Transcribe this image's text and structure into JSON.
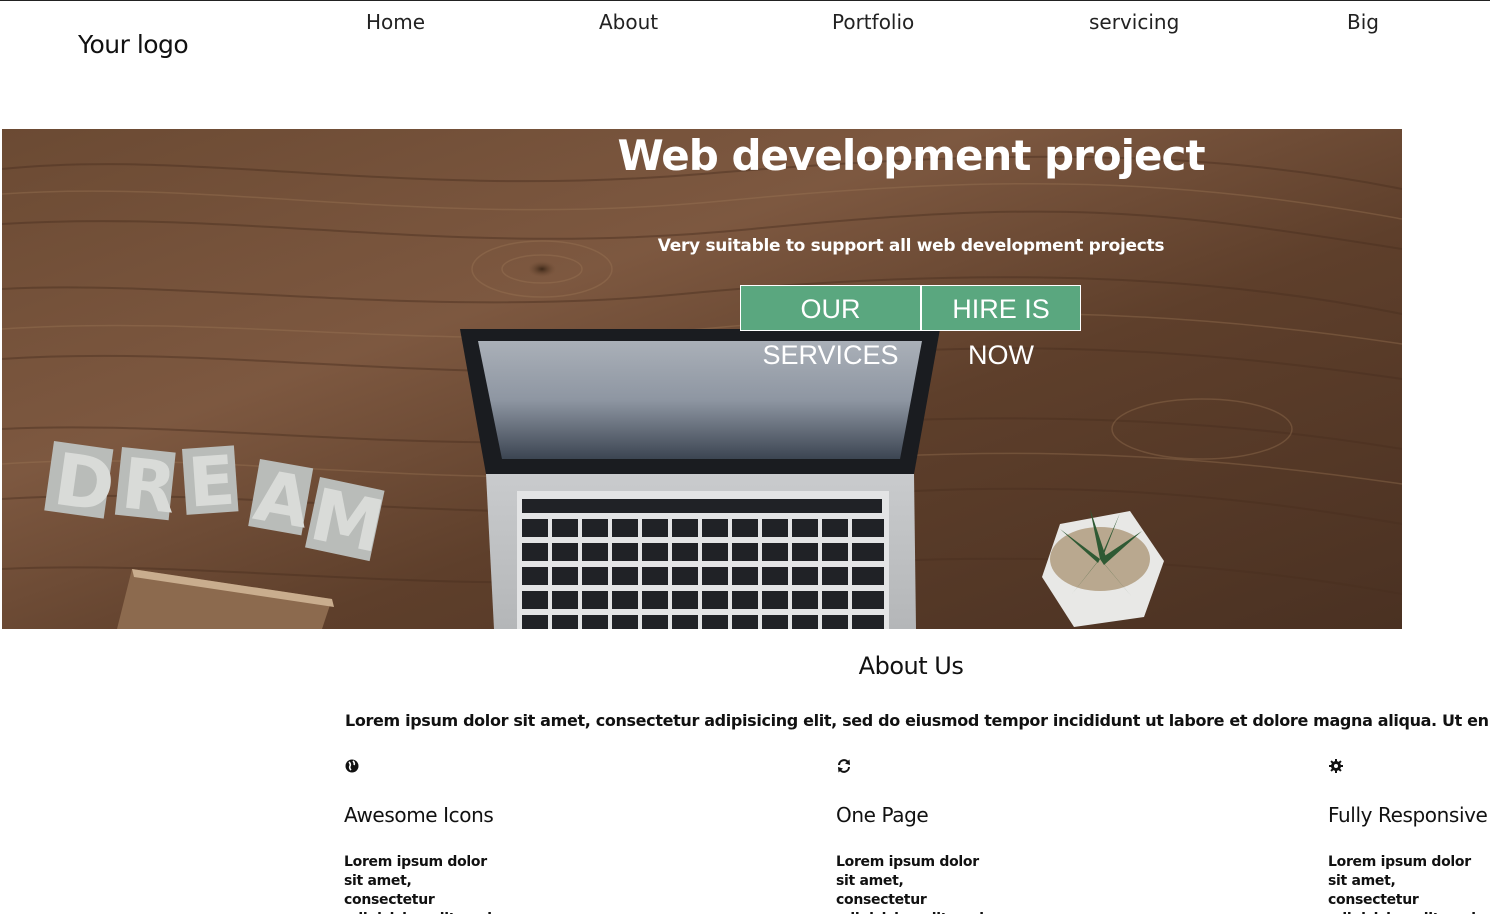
{
  "header": {
    "logo": "Your logo",
    "nav": [
      "Home",
      "About",
      "Portfolio",
      "servicing",
      "Big"
    ]
  },
  "hero": {
    "title": "Web development project",
    "subtitle": "Very suitable to support all web development projects",
    "primary_button": "OUR SERVICES",
    "secondary_button": "HIRE IS NOW",
    "button_color": "#5aa77f",
    "decor_letters": [
      "D",
      "R",
      "E",
      "A",
      "M"
    ]
  },
  "about": {
    "title": "About Us",
    "text": "Lorem ipsum dolor sit amet, consectetur adipisicing elit, sed do eiusmod tempor incididunt ut labore et dolore magna aliqua. Ut enim ad minim veniam,"
  },
  "features": [
    {
      "icon": "globe-icon",
      "title": "Awesome Icons",
      "text": "Lorem ipsum dolor sit amet, consectetur adipisicing elit, sed do"
    },
    {
      "icon": "refresh-icon",
      "title": "One Page",
      "text": "Lorem ipsum dolor sit amet, consectetur adipisicing elit, sed do"
    },
    {
      "icon": "gear-icon",
      "title": "Fully Responsive",
      "text": "Lorem ipsum dolor sit amet, consectetur adipisicing elit, sed do"
    }
  ]
}
